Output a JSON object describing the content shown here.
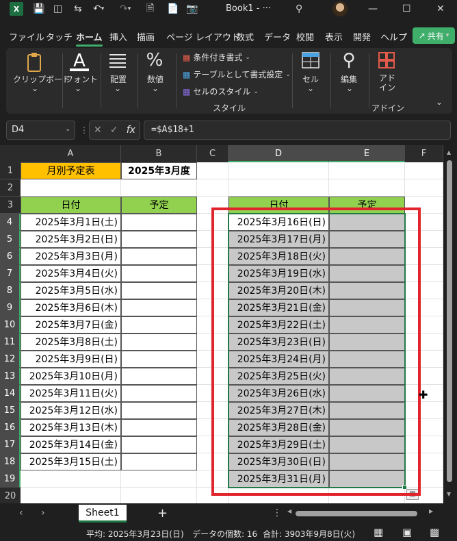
{
  "titlebar": {
    "app_logo": "X",
    "book_title": "Book1 - ···",
    "icons": [
      "save-icon",
      "autosave-icon",
      "switch-icon",
      "undo-icon",
      "redo-icon",
      "print-preview-icon",
      "file-icon",
      "camera-icon"
    ]
  },
  "menu": {
    "tabs": [
      "ファイル",
      "タッチ",
      "ホーム",
      "挿入",
      "描画",
      "ページ レイアウト",
      "数式",
      "データ",
      "校閲",
      "表示",
      "開発",
      "ヘルプ"
    ],
    "active": "ホーム",
    "share_label": "共有"
  },
  "ribbon": {
    "clipboard": "クリップボード",
    "font": "フォント",
    "alignment": "配置",
    "number": "数値",
    "cond_format": "条件付き書式",
    "format_table": "テーブルとして書式設定",
    "cell_style": "セルのスタイル",
    "style_group": "スタイル",
    "cells": "セル",
    "edit": "編集",
    "addin": "アド\nイン",
    "addin_group": "アドイン",
    "number_glyph": "%",
    "font_glyph": "A"
  },
  "formula_bar": {
    "name_box": "D4",
    "formula": "=$A$18+1",
    "fx": "fx"
  },
  "columns": [
    "A",
    "B",
    "C",
    "D",
    "E",
    "F"
  ],
  "rows": [
    "1",
    "2",
    "3",
    "4",
    "5",
    "6",
    "7",
    "8",
    "9",
    "10",
    "11",
    "12",
    "13",
    "14",
    "15",
    "16",
    "17",
    "18",
    "19",
    "20"
  ],
  "sheet": {
    "A1": "月別予定表",
    "B1": "2025年3月度",
    "A3": "日付",
    "B3": "予定",
    "D3": "日付",
    "E3": "予定",
    "colA": [
      "2025年3月1日(土)",
      "2025年3月2日(日)",
      "2025年3月3日(月)",
      "2025年3月4日(火)",
      "2025年3月5日(水)",
      "2025年3月6日(木)",
      "2025年3月7日(金)",
      "2025年3月8日(土)",
      "2025年3月9日(日)",
      "2025年3月10日(月)",
      "2025年3月11日(火)",
      "2025年3月12日(水)",
      "2025年3月13日(木)",
      "2025年3月14日(金)",
      "2025年3月15日(土)"
    ],
    "colD": [
      "2025年3月16日(日)",
      "2025年3月17日(月)",
      "2025年3月18日(火)",
      "2025年3月19日(水)",
      "2025年3月20日(木)",
      "2025年3月21日(金)",
      "2025年3月22日(土)",
      "2025年3月23日(日)",
      "2025年3月24日(月)",
      "2025年3月25日(火)",
      "2025年3月26日(水)",
      "2025年3月27日(木)",
      "2025年3月28日(金)",
      "2025年3月29日(土)",
      "2025年3月30日(日)",
      "2025年3月31日(月)"
    ]
  },
  "colors": {
    "orange": "#ffc000",
    "green_header": "#92d050",
    "selection_gray": "#c8c8c8",
    "highlight_red": "#e1232b"
  },
  "sheet_tabs": {
    "active": "Sheet1",
    "add": "+"
  },
  "status": {
    "average": "平均: 2025年3月23日(日)",
    "count": "データの個数: 16",
    "sum": "合計: 3903年9月8日(火)"
  }
}
